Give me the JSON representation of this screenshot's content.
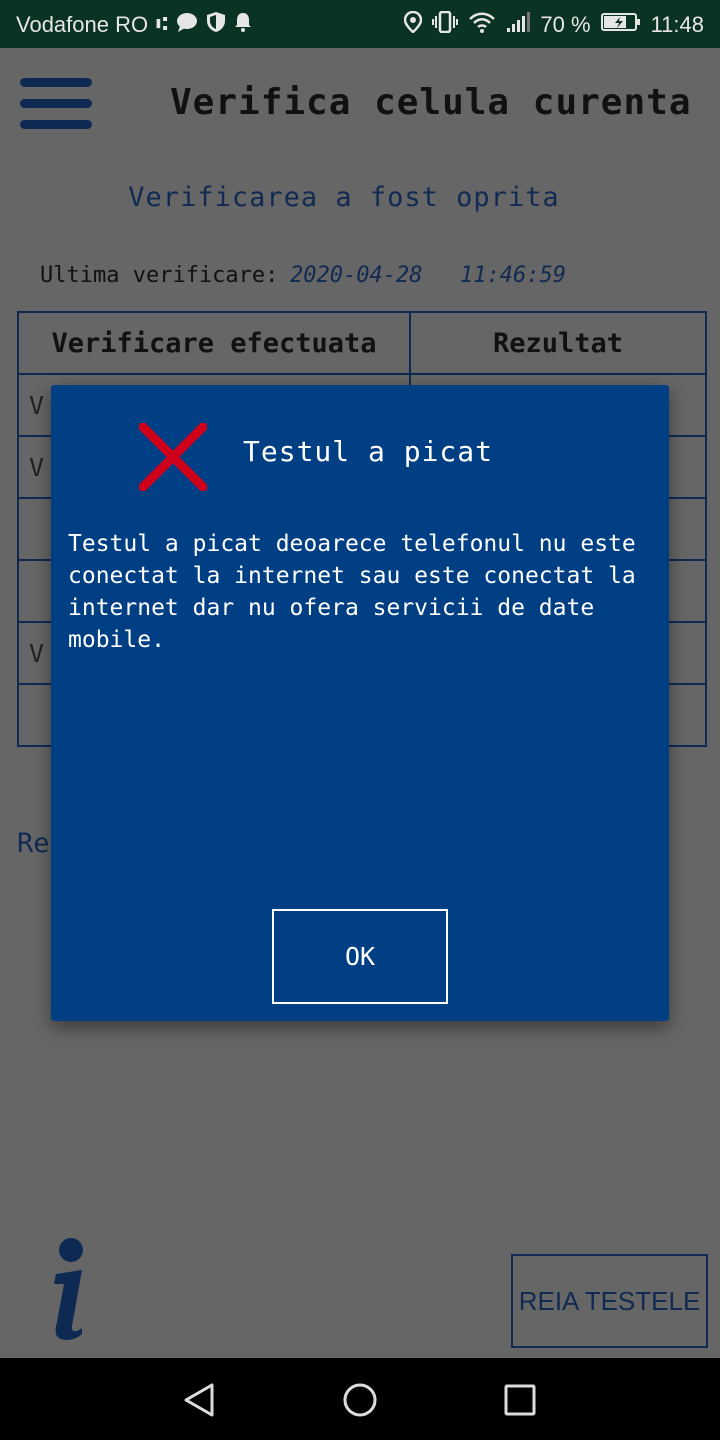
{
  "status_bar": {
    "carrier": "Vodafone RO",
    "battery": "70 %",
    "time": "11:48",
    "icons_left": [
      "usb-icon",
      "chat-icon",
      "shield-icon",
      "bell-icon"
    ],
    "icons_right": [
      "location-icon",
      "vibrate-icon",
      "wifi-icon",
      "signal-icon",
      "battery-icon"
    ]
  },
  "header": {
    "title": "Verifica celula curenta",
    "menu_icon": "hamburger-menu-icon"
  },
  "status_text": "Verificarea a fost oprita",
  "last_check": {
    "label": "Ultima verificare:",
    "date": "2020-04-28",
    "time": "11:46:59"
  },
  "table": {
    "headers": [
      "Verificare efectuata",
      "Rezultat"
    ],
    "rows": [
      {
        "col1": "V",
        "col2": ""
      },
      {
        "col1": "V",
        "col2": ""
      },
      {
        "col1": "",
        "col2": ""
      },
      {
        "col1": "",
        "col2": ""
      },
      {
        "col1": "V",
        "col2": ""
      },
      {
        "col1": "",
        "col2": ""
      }
    ]
  },
  "partial_label": "Re",
  "footer": {
    "info_icon": "info-icon",
    "retry_label": "REIA TESTELE"
  },
  "dialog": {
    "title": "Testul a picat",
    "message": "Testul a picat deoarece telefonul nu este conectat la internet sau este conectat la internet dar nu ofera servicii de date mobile.",
    "ok_label": "OK",
    "icon": "fail-x-icon",
    "icon_color": "#d0021b"
  },
  "colors": {
    "primary": "#003f84",
    "dim_background": "#666666",
    "status_bar": "#0b3324",
    "accent_dark": "#102a52"
  }
}
